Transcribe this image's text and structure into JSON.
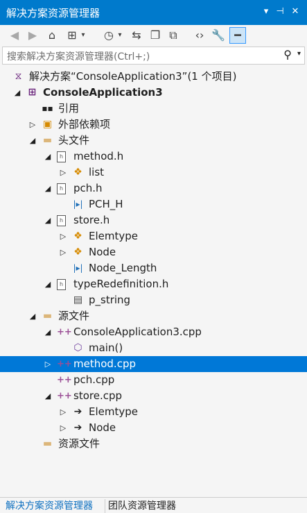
{
  "window": {
    "title": "解决方案资源管理器",
    "buttons": [
      "dropdown-icon",
      "pin-icon",
      "close-icon"
    ]
  },
  "toolbar": {
    "tools": [
      "back-icon",
      "forward-icon",
      "home-icon",
      "switch-views-icon",
      "dropdown-icon",
      "pending-changes-icon",
      "dropdown-icon",
      "sync-icon",
      "collapse-all-icon",
      "show-all-files-icon",
      "view-code-icon",
      "properties-icon",
      "preview-selected-icon"
    ]
  },
  "search": {
    "placeholder": "搜索解决方案资源管理器(Ctrl+;)"
  },
  "tree": [
    {
      "label": "解决方案“ConsoleApplication3”(1 个项目)",
      "icon": "solution-icon",
      "expander": ""
    },
    {
      "label": "ConsoleApplication3",
      "icon": "cpp-project-icon",
      "expander": "expanded",
      "bold": true
    },
    {
      "label": "引用",
      "icon": "references-icon",
      "expander": ""
    },
    {
      "label": "外部依赖项",
      "icon": "external-dependencies-icon",
      "expander": "collapsed"
    },
    {
      "label": "头文件",
      "icon": "filter-folder-icon",
      "expander": "expanded"
    },
    {
      "label": "method.h",
      "icon": "header-file-icon",
      "expander": "expanded"
    },
    {
      "label": "list",
      "icon": "class-icon",
      "expander": "collapsed"
    },
    {
      "label": "pch.h",
      "icon": "header-file-icon",
      "expander": "expanded"
    },
    {
      "label": "PCH_H",
      "icon": "macro-icon",
      "expander": ""
    },
    {
      "label": "store.h",
      "icon": "header-file-icon",
      "expander": "expanded"
    },
    {
      "label": "Elemtype",
      "icon": "class-icon",
      "expander": "collapsed"
    },
    {
      "label": "Node",
      "icon": "class-icon",
      "expander": "collapsed"
    },
    {
      "label": "Node_Length",
      "icon": "macro-icon",
      "expander": ""
    },
    {
      "label": "typeRedefinition.h",
      "icon": "header-file-icon",
      "expander": "expanded"
    },
    {
      "label": "p_string",
      "icon": "typedef-icon",
      "expander": ""
    },
    {
      "label": "源文件",
      "icon": "filter-folder-icon",
      "expander": "expanded"
    },
    {
      "label": "ConsoleApplication3.cpp",
      "icon": "cpp-file-icon",
      "expander": "expanded"
    },
    {
      "label": "main()",
      "icon": "method-icon",
      "expander": ""
    },
    {
      "label": "method.cpp",
      "icon": "cpp-file-icon",
      "expander": "collapsed",
      "selected": true
    },
    {
      "label": "pch.cpp",
      "icon": "cpp-file-icon",
      "expander": ""
    },
    {
      "label": "store.cpp",
      "icon": "cpp-file-icon",
      "expander": "expanded"
    },
    {
      "label": "Elemtype",
      "icon": "arrow-icon",
      "expander": "collapsed"
    },
    {
      "label": "Node",
      "icon": "arrow-icon",
      "expander": "collapsed"
    },
    {
      "label": "资源文件",
      "icon": "filter-folder-icon",
      "expander": ""
    }
  ],
  "bottom_tabs": [
    {
      "label": "解决方案资源管理器",
      "active": true
    },
    {
      "label": "团队资源管理器",
      "active": false
    }
  ]
}
